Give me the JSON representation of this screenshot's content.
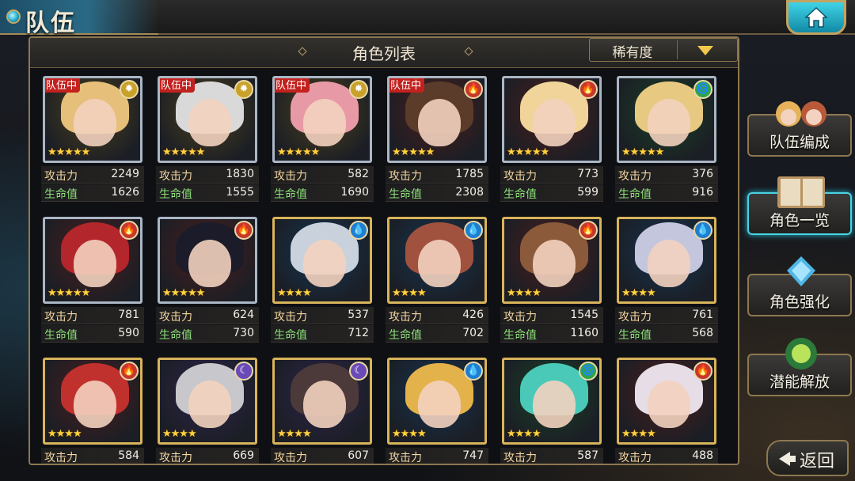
{
  "header": {
    "title": "队伍",
    "home_icon": "home-icon"
  },
  "panel": {
    "title": "角色列表",
    "sort_label": "稀有度"
  },
  "labels": {
    "atk": "攻击力",
    "hp": "生命值",
    "team": "队伍中"
  },
  "colors": {
    "fire": "#c7372b",
    "water": "#1f7fd1",
    "wind": "#2fa44a",
    "light": "#c9a12a",
    "dark": "#6a4ab8"
  },
  "characters": [
    {
      "team": true,
      "element": "light",
      "stars": 5,
      "frame": "silver",
      "hair": "#e6c07a",
      "atk": "2249",
      "hp": "1626"
    },
    {
      "team": true,
      "element": "light",
      "stars": 5,
      "frame": "silver",
      "hair": "#d9d9d9",
      "atk": "1830",
      "hp": "1555"
    },
    {
      "team": true,
      "element": "light",
      "stars": 5,
      "frame": "silver",
      "hair": "#e79aa5",
      "atk": "582",
      "hp": "1690"
    },
    {
      "team": true,
      "element": "fire",
      "stars": 5,
      "frame": "silver",
      "hair": "#5b3b2a",
      "atk": "1785",
      "hp": "2308"
    },
    {
      "team": false,
      "element": "fire",
      "stars": 5,
      "frame": "silver",
      "hair": "#f0d49a",
      "atk": "773",
      "hp": "599"
    },
    {
      "team": false,
      "element": "wind",
      "stars": 5,
      "frame": "silver",
      "hair": "#e8c982",
      "atk": "376",
      "hp": "916"
    },
    {
      "team": false,
      "element": "fire",
      "stars": 5,
      "frame": "silver",
      "hair": "#b3262b",
      "atk": "781",
      "hp": "590"
    },
    {
      "team": false,
      "element": "fire",
      "stars": 5,
      "frame": "silver",
      "hair": "#1b1b2a",
      "atk": "624",
      "hp": "730"
    },
    {
      "team": false,
      "element": "water",
      "stars": 4,
      "frame": "gold",
      "hair": "#c9d2dc",
      "atk": "537",
      "hp": "712"
    },
    {
      "team": false,
      "element": "water",
      "stars": 4,
      "frame": "gold",
      "hair": "#a0523e",
      "atk": "426",
      "hp": "702"
    },
    {
      "team": false,
      "element": "fire",
      "stars": 4,
      "frame": "gold",
      "hair": "#8a5a3a",
      "atk": "1545",
      "hp": "1160"
    },
    {
      "team": false,
      "element": "water",
      "stars": 4,
      "frame": "gold",
      "hair": "#c4c6de",
      "atk": "761",
      "hp": "568"
    },
    {
      "team": false,
      "element": "fire",
      "stars": 4,
      "frame": "gold",
      "hair": "#c0302c",
      "atk": "584",
      "hp": ""
    },
    {
      "team": false,
      "element": "dark",
      "stars": 4,
      "frame": "gold",
      "hair": "#c8c8cc",
      "atk": "669",
      "hp": ""
    },
    {
      "team": false,
      "element": "dark",
      "stars": 4,
      "frame": "gold",
      "hair": "#4c3a3a",
      "atk": "607",
      "hp": ""
    },
    {
      "team": false,
      "element": "water",
      "stars": 4,
      "frame": "gold",
      "hair": "#e4b24a",
      "atk": "747",
      "hp": ""
    },
    {
      "team": false,
      "element": "wind",
      "stars": 4,
      "frame": "gold",
      "hair": "#4ac9b8",
      "atk": "587",
      "hp": ""
    },
    {
      "team": false,
      "element": "fire",
      "stars": 4,
      "frame": "gold",
      "hair": "#e6dde6",
      "atk": "488",
      "hp": ""
    }
  ],
  "side_menu": [
    {
      "label": "队伍编成",
      "icon": "team-portrait-icon",
      "active": false
    },
    {
      "label": "角色一览",
      "icon": "book-icon",
      "active": true
    },
    {
      "label": "角色强化",
      "icon": "enhance-crystal-icon",
      "active": false
    },
    {
      "label": "潜能解放",
      "icon": "potential-orb-icon",
      "active": false
    }
  ],
  "back": {
    "label": "返回"
  }
}
